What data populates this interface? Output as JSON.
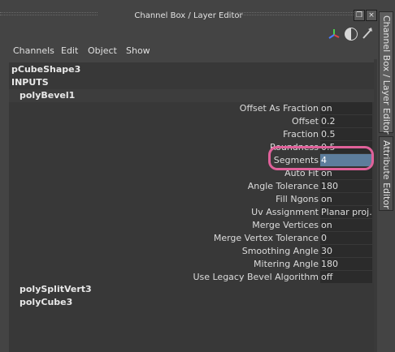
{
  "window": {
    "title": "Channel Box / Layer Editor",
    "float_icon": "restore-window-icon",
    "close_label": "×"
  },
  "icons": [
    "axis-gizmo-icon",
    "half-contrast-icon",
    "pick-arrow-icon"
  ],
  "menu": [
    "Channels",
    "Edit",
    "Object",
    "Show"
  ],
  "object_name": "pCubeShape3",
  "inputs_label": "INPUTS",
  "node": "polyBevel1",
  "attributes": [
    {
      "label": "Offset As Fraction",
      "value": "on"
    },
    {
      "label": "Offset",
      "value": "0.2"
    },
    {
      "label": "Fraction",
      "value": "0.5"
    },
    {
      "label": "Roundness",
      "value": "0.5"
    },
    {
      "label": "Segments",
      "value": "4",
      "selected": true
    },
    {
      "label": "Auto Fit",
      "value": "on"
    },
    {
      "label": "Angle Tolerance",
      "value": "180"
    },
    {
      "label": "Fill Ngons",
      "value": "on"
    },
    {
      "label": "Uv Assignment",
      "value": "Planar proj..."
    },
    {
      "label": "Merge Vertices",
      "value": "on"
    },
    {
      "label": "Merge Vertex Tolerance",
      "value": "0"
    },
    {
      "label": "Smoothing Angle",
      "value": "30"
    },
    {
      "label": "Mitering Angle",
      "value": "180"
    },
    {
      "label": "Use Legacy Bevel Algorithm",
      "value": "off"
    }
  ],
  "sub_nodes": [
    "polySplitVert3",
    "polyCube3"
  ],
  "side_tabs": [
    {
      "label": "Channel Box / Layer Editor",
      "active": true
    },
    {
      "label": "Attribute Editor",
      "active": false
    }
  ],
  "colors": {
    "panel": "#444444",
    "content": "#383838",
    "selected_field": "#5d7d9c",
    "highlight_ring": "#e0619a"
  }
}
